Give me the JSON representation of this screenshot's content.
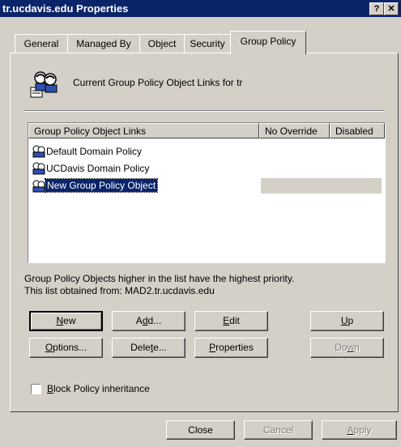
{
  "window": {
    "title": "tr.ucdavis.edu Properties",
    "help_button": "?",
    "close_button": "✕"
  },
  "tabs": [
    {
      "label": "General"
    },
    {
      "label": "Managed By"
    },
    {
      "label": "Object"
    },
    {
      "label": "Security"
    },
    {
      "label": "Group Policy",
      "active": true
    }
  ],
  "header": {
    "label": "Current Group Policy Object Links for tr",
    "icon": "group-policy-icon"
  },
  "list": {
    "columns": [
      "Group Policy Object Links",
      "No Override",
      "Disabled"
    ],
    "rows": [
      {
        "name": "Default Domain Policy",
        "icon": "gpo-icon"
      },
      {
        "name": "UCDavis Domain Policy",
        "icon": "gpo-icon"
      },
      {
        "name": "New Group Policy Object",
        "icon": "gpo-icon",
        "selected": true,
        "editing": true
      }
    ]
  },
  "info": {
    "line1": "Group Policy Objects higher in the list have the highest priority.",
    "line2": "This list obtained from: MAD2.tr.ucdavis.edu"
  },
  "buttons": {
    "new": {
      "pre": "",
      "accel": "N",
      "post": "ew"
    },
    "add": {
      "pre": "A",
      "accel": "d",
      "post": "d..."
    },
    "edit": {
      "pre": "",
      "accel": "E",
      "post": "dit"
    },
    "up": {
      "pre": "",
      "accel": "U",
      "post": "p"
    },
    "options": {
      "pre": "",
      "accel": "O",
      "post": "ptions..."
    },
    "delete": {
      "pre": "Dele",
      "accel": "t",
      "post": "e..."
    },
    "properties": {
      "pre": "",
      "accel": "P",
      "post": "roperties"
    },
    "down": {
      "pre": "Do",
      "accel": "w",
      "post": "n"
    }
  },
  "checkbox": {
    "pre": "",
    "accel": "B",
    "post": "lock Policy inheritance",
    "checked": false
  },
  "dialog_buttons": {
    "close": "Close",
    "cancel": "Cancel",
    "apply": {
      "pre": "",
      "accel": "A",
      "post": "pply"
    }
  },
  "colors": {
    "titlebar": "#0a246a",
    "face": "#d4d0c8",
    "selection": "#0a246a"
  }
}
